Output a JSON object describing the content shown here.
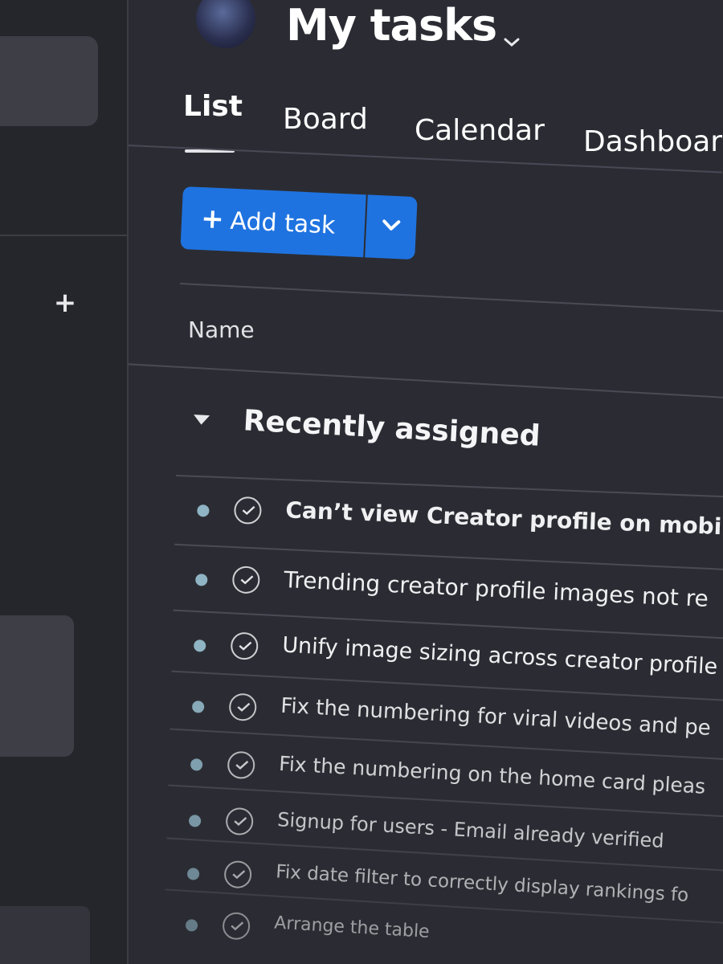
{
  "header": {
    "title": "My tasks"
  },
  "tabs": [
    {
      "label": "List"
    },
    {
      "label": "Board"
    },
    {
      "label": "Calendar"
    },
    {
      "label": "Dashboard"
    }
  ],
  "toolbar": {
    "add_task_label": "Add task",
    "add_task_icon": "plus-icon",
    "dropdown_icon": "chevron-down-icon"
  },
  "table": {
    "column_name": "Name"
  },
  "section": {
    "title": "Recently assigned",
    "tasks": [
      {
        "name": "Can’t view Creator profile on mobile"
      },
      {
        "name": "Trending creator profile images not re"
      },
      {
        "name": "Unify image sizing across creator profile"
      },
      {
        "name": "Fix the numbering for viral videos and pe"
      },
      {
        "name": "Fix the numbering on the home card pleas"
      },
      {
        "name": "Signup for users - Email already verified"
      },
      {
        "name": "Fix date filter to correctly display rankings fo"
      },
      {
        "name": "Arrange the table"
      }
    ]
  },
  "colors": {
    "accent": "#1f73e0",
    "background": "#2b2c33",
    "sidebar": "#25262c",
    "status_dot": "#8fb4c4"
  }
}
